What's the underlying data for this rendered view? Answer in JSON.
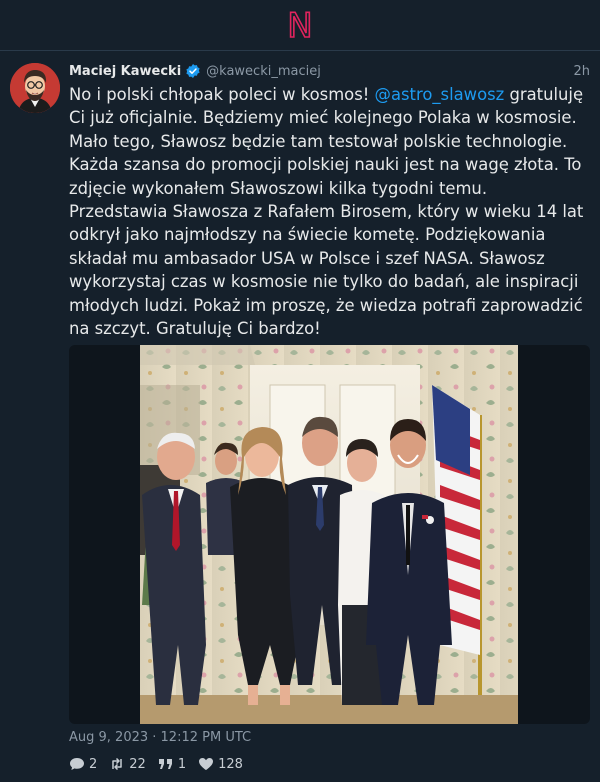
{
  "app": {
    "logo_letter": "N",
    "accent": "#e0245e",
    "link_color": "#1d9bf0"
  },
  "post": {
    "author_name": "Maciej Kawecki",
    "author_handle": "@kawecki_maciej",
    "verified": true,
    "time_ago": "2h",
    "text_before_mention": "No i polski chłopak poleci w kosmos!",
    "mention": "@astro_slawosz",
    "text_after_mention": "gratuluję Ci już oficjalnie. Będziemy mieć kolejnego Polaka w kosmosie. Mało tego, Sławosz będzie tam testował polskie technologie. Każda szansa do promocji polskiej nauki jest na wagę złota. To zdjęcie wykonałem Sławoszowi kilka tygodni temu. Przedstawia Sławosza z Rafałem Birosem, który w wieku 14 lat odkrył jako najmłodszy na świecie kometę. Podziękowania składał mu ambasador USA w Polsce i szef NASA. Sławosz wykorzystaj czas w kosmosie nie tylko do badań, ale inspiracji młodych ludzi. Pokaż im proszę, że wiedza potrafi zaprowadzić na szczyt. Gratuluję Ci bardzo!",
    "date": "Aug 9, 2023 · 12:12 PM UTC",
    "stats": {
      "replies": "2",
      "reposts": "22",
      "quotes": "1",
      "likes": "128"
    }
  },
  "icons": {
    "verified": "verified-badge-icon",
    "reply": "reply-icon",
    "repost": "repost-icon",
    "quote": "quote-icon",
    "like": "heart-icon"
  }
}
